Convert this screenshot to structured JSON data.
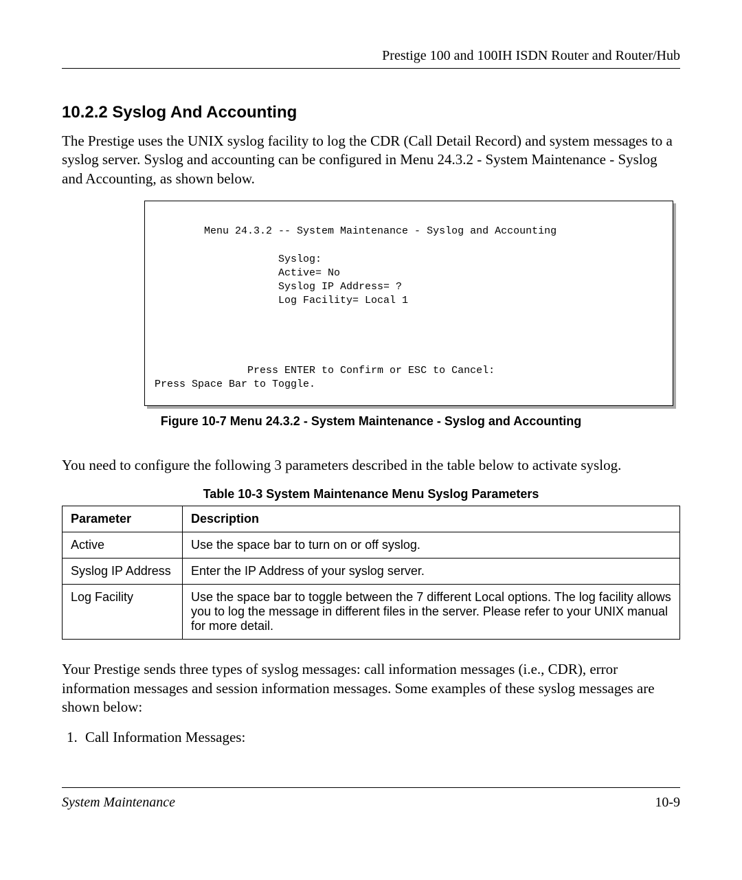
{
  "header": {
    "title": "Prestige 100 and 100IH ISDN Router and Router/Hub"
  },
  "section": {
    "number": "10.2.2",
    "title": "Syslog And Accounting"
  },
  "intro_paragraph": "The Prestige uses the UNIX syslog facility to log the CDR (Call Detail Record) and system messages to a syslog server. Syslog and accounting can be configured in Menu 24.3.2 - System Maintenance - Syslog and Accounting, as shown below.",
  "terminal": {
    "title_line": "        Menu 24.3.2 -- System Maintenance - Syslog and Accounting",
    "body_lines": [
      "                    Syslog:",
      "                    Active= No",
      "                    Syslog IP Address= ?",
      "                    Log Facility= Local 1"
    ],
    "prompt_line": "               Press ENTER to Confirm or ESC to Cancel:",
    "toggle_line": "Press Space Bar to Toggle."
  },
  "figure_caption": "Figure 10-7 Menu 24.3.2 - System Maintenance - Syslog and Accounting",
  "post_figure_paragraph": "You need to configure the following 3 parameters described in the table below to activate syslog.",
  "table_caption": "Table 10-3 System Maintenance Menu Syslog Parameters",
  "table": {
    "headers": [
      "Parameter",
      "Description"
    ],
    "rows": [
      {
        "param": "Active",
        "desc": "Use the space bar to turn on or off syslog."
      },
      {
        "param": "Syslog IP Address",
        "desc": "Enter the IP Address of your syslog server."
      },
      {
        "param": "Log Facility",
        "desc": "Use the space bar to toggle between the 7 different Local options. The log facility allows you to log the message in different files in the server. Please refer to your UNIX manual for more detail."
      }
    ]
  },
  "post_table_paragraph": "Your Prestige sends three types of syslog messages: call information messages (i.e., CDR), error information messages and session information messages. Some examples of these syslog messages are shown below:",
  "list": {
    "items": [
      "Call Information Messages:"
    ]
  },
  "footer": {
    "left": "System Maintenance",
    "right": "10-9"
  }
}
